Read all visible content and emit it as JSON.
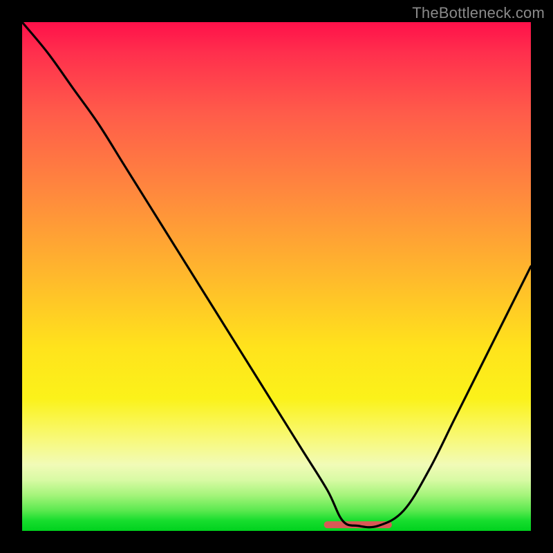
{
  "watermark_text": "TheBottleneck.com",
  "chart_data": {
    "type": "line",
    "title": "",
    "xlabel": "",
    "ylabel": "",
    "xlim": [
      0,
      100
    ],
    "ylim": [
      0,
      100
    ],
    "grid": false,
    "legend": false,
    "series": [
      {
        "name": "bottleneck-curve",
        "x": [
          0,
          5,
          10,
          15,
          20,
          25,
          30,
          35,
          40,
          45,
          50,
          55,
          60,
          63,
          66,
          70,
          75,
          80,
          85,
          90,
          95,
          100
        ],
        "y": [
          100,
          94,
          87,
          80,
          72,
          64,
          56,
          48,
          40,
          32,
          24,
          16,
          8,
          2,
          1,
          1,
          4,
          12,
          22,
          32,
          42,
          52
        ]
      },
      {
        "name": "valley-highlight",
        "x": [
          60,
          72
        ],
        "y": [
          1.2,
          1.2
        ]
      }
    ],
    "annotations": [
      {
        "text": "TheBottleneck.com",
        "role": "watermark",
        "position": "top-right"
      }
    ],
    "background_gradient_stops": [
      {
        "pos": 0.0,
        "color": "#ff104a"
      },
      {
        "pos": 0.18,
        "color": "#ff5c4a"
      },
      {
        "pos": 0.5,
        "color": "#ffb92c"
      },
      {
        "pos": 0.74,
        "color": "#fbf21a"
      },
      {
        "pos": 0.9,
        "color": "#d8faa4"
      },
      {
        "pos": 1.0,
        "color": "#00d21e"
      }
    ]
  }
}
